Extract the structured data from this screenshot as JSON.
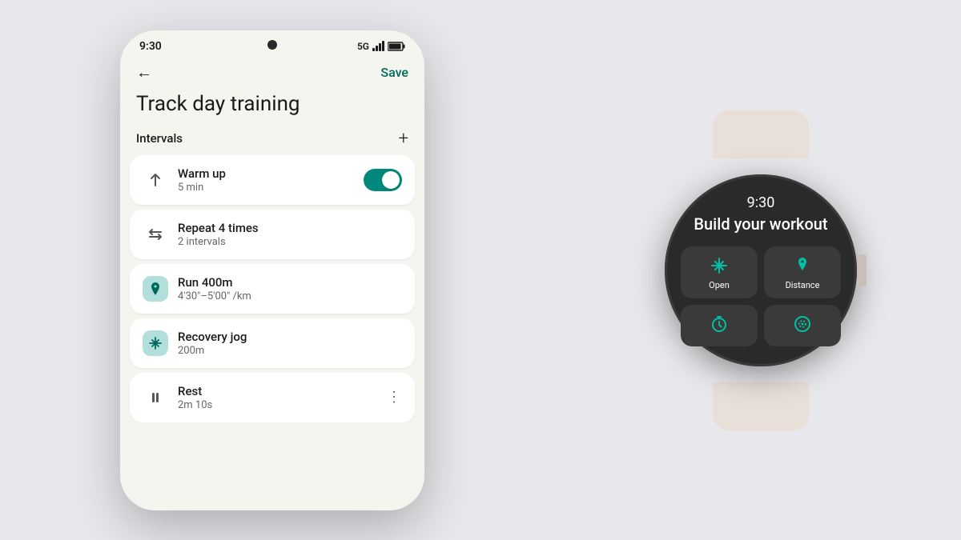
{
  "scene": {
    "bg_color": "#e8e8ec"
  },
  "phone": {
    "time": "9:30",
    "network": "5G",
    "header": {
      "back_label": "←",
      "save_label": "Save"
    },
    "title": "Track day training",
    "intervals_section": {
      "label": "Intervals",
      "add_icon": "+"
    },
    "cards": [
      {
        "id": "warmup",
        "icon_type": "arrow-up",
        "title": "Warm up",
        "subtitle": "5 min",
        "has_toggle": true,
        "toggle_on": true
      },
      {
        "id": "repeat",
        "icon_type": "repeat",
        "title": "Repeat 4 times",
        "subtitle": "2 intervals",
        "has_toggle": false
      },
      {
        "id": "run",
        "icon_type": "location-green",
        "title": "Run 400m",
        "subtitle": "4'30\"–5'00\" /km",
        "has_toggle": false
      },
      {
        "id": "recovery",
        "icon_type": "move-green",
        "title": "Recovery jog",
        "subtitle": "200m",
        "has_toggle": false
      },
      {
        "id": "rest",
        "icon_type": "pause",
        "title": "Rest",
        "subtitle": "2m 10s",
        "has_toggle": false,
        "has_dots": true
      }
    ]
  },
  "watch": {
    "time": "9:30",
    "title": "Build your workout",
    "buttons": [
      {
        "id": "open",
        "label": "Open",
        "icon": "move"
      },
      {
        "id": "distance",
        "label": "Distance",
        "icon": "location"
      },
      {
        "id": "time-icon",
        "label": "",
        "icon": "timer"
      },
      {
        "id": "pace-icon",
        "label": "",
        "icon": "pace"
      }
    ]
  }
}
